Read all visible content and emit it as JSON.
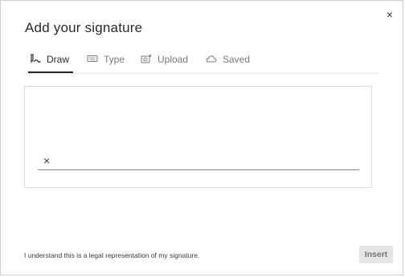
{
  "dialog": {
    "title": "Add your signature",
    "close_glyph": "×"
  },
  "tabs": [
    {
      "label": "Draw",
      "icon": "draw-icon",
      "active": true
    },
    {
      "label": "Type",
      "icon": "keyboard-icon",
      "active": false
    },
    {
      "label": "Upload",
      "icon": "upload-image-icon",
      "active": false
    },
    {
      "label": "Saved",
      "icon": "cloud-icon",
      "active": false
    }
  ],
  "canvas": {
    "x_mark": "×"
  },
  "footer": {
    "disclaimer": "I understand this is a legal representation of my signature.",
    "insert_label": "Insert"
  }
}
